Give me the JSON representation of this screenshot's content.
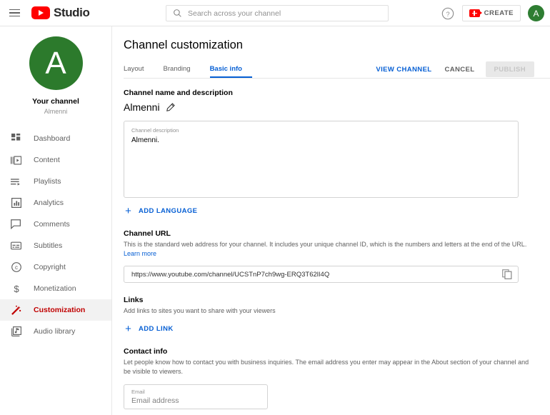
{
  "topbar": {
    "menu_icon": "hamburger-icon",
    "logo_icon": "youtube-play-icon",
    "brand": "Studio",
    "search": {
      "icon": "search-icon",
      "placeholder": "Search across your channel",
      "value": ""
    },
    "help_icon": "help-circle-icon",
    "create": {
      "icon": "video-camera-plus-icon",
      "label": "CREATE"
    },
    "avatar": {
      "initial": "A",
      "color": "#2e7d32"
    }
  },
  "sidebar": {
    "avatar": {
      "initial": "A",
      "color": "#2c7a2c"
    },
    "your_channel_label": "Your channel",
    "channel_name": "Almenni",
    "items": [
      {
        "label": "Dashboard",
        "icon": "dashboard-icon",
        "active": false
      },
      {
        "label": "Content",
        "icon": "content-icon",
        "active": false
      },
      {
        "label": "Playlists",
        "icon": "playlists-icon",
        "active": false
      },
      {
        "label": "Analytics",
        "icon": "analytics-icon",
        "active": false
      },
      {
        "label": "Comments",
        "icon": "comments-icon",
        "active": false
      },
      {
        "label": "Subtitles",
        "icon": "subtitles-icon",
        "active": false
      },
      {
        "label": "Copyright",
        "icon": "copyright-icon",
        "active": false
      },
      {
        "label": "Monetization",
        "icon": "dollar-icon",
        "active": false
      },
      {
        "label": "Customization",
        "icon": "magic-wand-icon",
        "active": true
      },
      {
        "label": "Audio library",
        "icon": "audio-library-icon",
        "active": false
      }
    ],
    "active_color": "#c00000"
  },
  "main": {
    "page_title": "Channel customization",
    "tabs": [
      {
        "label": "Layout",
        "active": false
      },
      {
        "label": "Branding",
        "active": false
      },
      {
        "label": "Basic info",
        "active": true
      }
    ],
    "accent_color": "#065fd4",
    "actions": {
      "view_channel": "VIEW CHANNEL",
      "cancel": "CANCEL",
      "publish": "PUBLISH"
    },
    "name_section": {
      "title": "Channel name and description",
      "channel_name": "Almenni",
      "edit_icon": "pencil-icon",
      "description_label": "Channel description",
      "description_value": "Almenni.",
      "add_language_label": "ADD LANGUAGE",
      "add_language_icon": "plus-icon"
    },
    "url_section": {
      "title": "Channel URL",
      "description": "This is the standard web address for your channel. It includes your unique channel ID, which is the numbers and letters at the end of the URL.",
      "learn_more": "Learn more",
      "url": "https://www.youtube.com/channel/UCSTnP7ch9wg-ERQ3T62lI4Q",
      "copy_icon": "copy-icon"
    },
    "links_section": {
      "title": "Links",
      "description": "Add links to sites you want to share with your viewers",
      "add_link_label": "ADD LINK",
      "add_link_icon": "plus-icon"
    },
    "contact_section": {
      "title": "Contact info",
      "description": "Let people know how to contact you with business inquiries. The email address you enter may appear in the About section of your channel and be visible to viewers.",
      "email_label": "Email",
      "email_placeholder": "Email address",
      "email_value": ""
    }
  }
}
